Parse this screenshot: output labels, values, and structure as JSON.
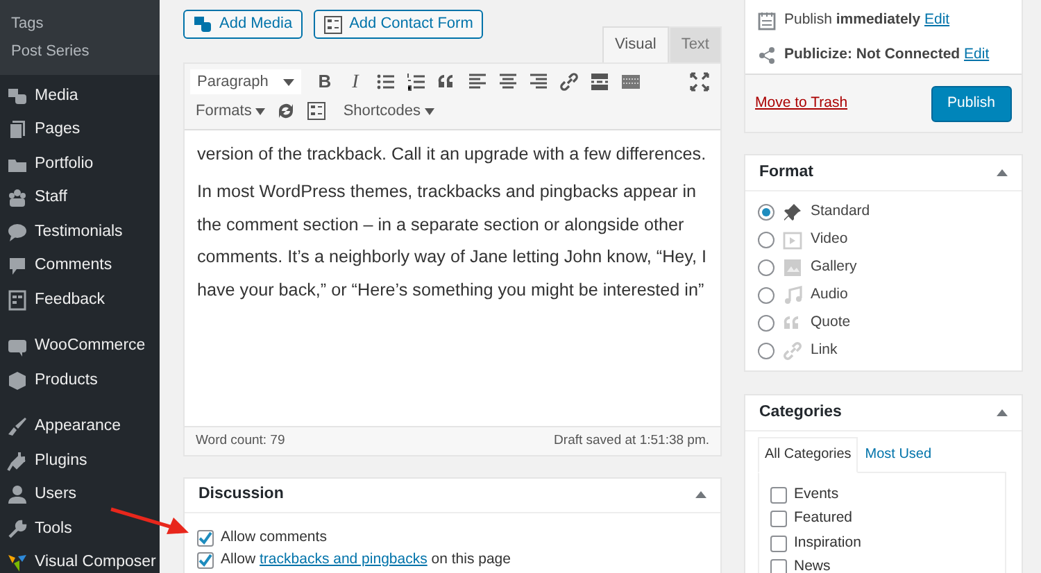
{
  "sidebar": {
    "submenu": [
      "Tags",
      "Post Series"
    ],
    "groups": [
      [
        "Media",
        "Pages",
        "Portfolio",
        "Staff",
        "Testimonials",
        "Comments",
        "Feedback"
      ],
      [
        "WooCommerce",
        "Products"
      ],
      [
        "Appearance",
        "Plugins",
        "Users",
        "Tools",
        "Visual Composer"
      ]
    ]
  },
  "editor": {
    "media_buttons": [
      "Add Media",
      "Add Contact Form"
    ],
    "tabs": [
      {
        "label": "Visual",
        "selected": true
      },
      {
        "label": "Text",
        "selected": false
      }
    ],
    "toolbar": {
      "format_select": "Paragraph",
      "bold": "B",
      "italic": "I",
      "formats_menu": "Formats",
      "shortcodes_menu": "Shortcodes"
    },
    "paragraphs": [
      "version of the trackback. Call it an upgrade with a few differences.",
      "In most WordPress themes, trackbacks and pingbacks appear in the comment section – in a separate section or alongside other comments. It’s a neighborly way of Jane letting John know, “Hey, I have your back,” or “Here’s something you might be interested in”"
    ],
    "word_count": "Word count: 79",
    "draft_status": "Draft saved at 1:51:38 pm."
  },
  "discussion": {
    "title": "Discussion",
    "options": [
      {
        "text": "Allow comments",
        "checked": true
      },
      {
        "text": "Allow ",
        "link": "trackbacks and pingbacks",
        "text_after": " on this page",
        "checked": true
      }
    ]
  },
  "publish": {
    "rows": [
      {
        "text": "Publish **immediately**",
        "link": "Edit"
      },
      {
        "text": "**Publicize: Not Connected**",
        "link": "Edit"
      }
    ],
    "trash": "Move to Trash",
    "button": "Publish"
  },
  "format": {
    "title": "Format",
    "options": [
      {
        "label": "Standard",
        "selected": true
      },
      {
        "label": "Video",
        "selected": false
      },
      {
        "label": "Gallery",
        "selected": false
      },
      {
        "label": "Audio",
        "selected": false
      },
      {
        "label": "Quote",
        "selected": false
      },
      {
        "label": "Link",
        "selected": false
      }
    ]
  },
  "categories": {
    "title": "Categories",
    "tabs": [
      {
        "label": "All Categories",
        "selected": true
      },
      {
        "label": "Most Used",
        "selected": false
      }
    ],
    "items": [
      {
        "label": "Events",
        "checked": false
      },
      {
        "label": "Featured",
        "checked": false
      },
      {
        "label": "Inspiration",
        "checked": false
      },
      {
        "label": "News",
        "checked": false
      }
    ]
  }
}
